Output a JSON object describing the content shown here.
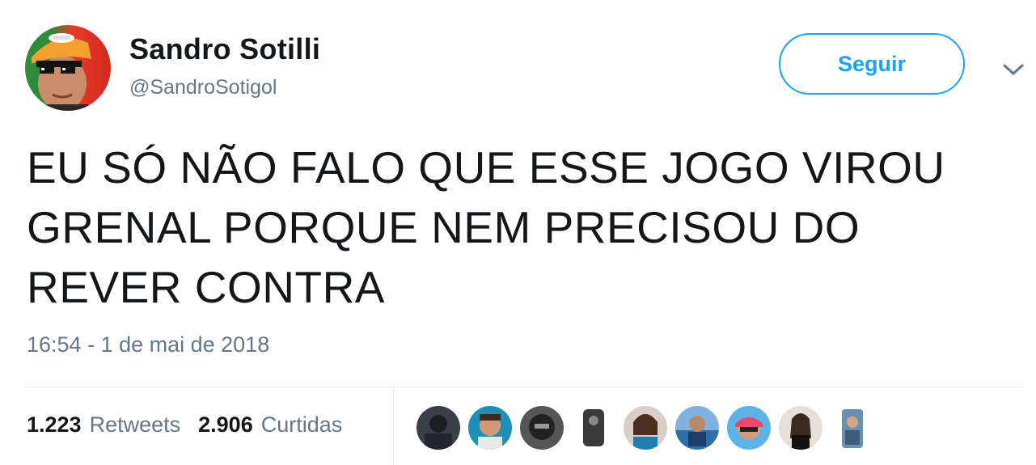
{
  "user": {
    "display_name": "Sandro Sotilli",
    "handle": "@SandroSotigol"
  },
  "follow_button": {
    "label": "Seguir",
    "accent_color": "#1da1f2"
  },
  "menu": {
    "icon": "chevron-down-icon"
  },
  "tweet": {
    "text": "EU SÓ NÃO FALO QUE ESSE JOGO VIROU GRENAL PORQUE NEM PRECISOU DO REVER CONTRA",
    "timestamp": "16:54 - 1 de mai de 2018"
  },
  "stats": {
    "retweets_count": "1.223",
    "retweets_label": "Retweets",
    "likes_count": "2.906",
    "likes_label": "Curtidas"
  },
  "likers": [
    {
      "icon": "liker-avatar"
    },
    {
      "icon": "liker-avatar"
    },
    {
      "icon": "liker-avatar"
    },
    {
      "icon": "liker-avatar"
    },
    {
      "icon": "liker-avatar"
    },
    {
      "icon": "liker-avatar"
    },
    {
      "icon": "liker-avatar"
    },
    {
      "icon": "liker-avatar"
    },
    {
      "icon": "liker-avatar"
    }
  ]
}
